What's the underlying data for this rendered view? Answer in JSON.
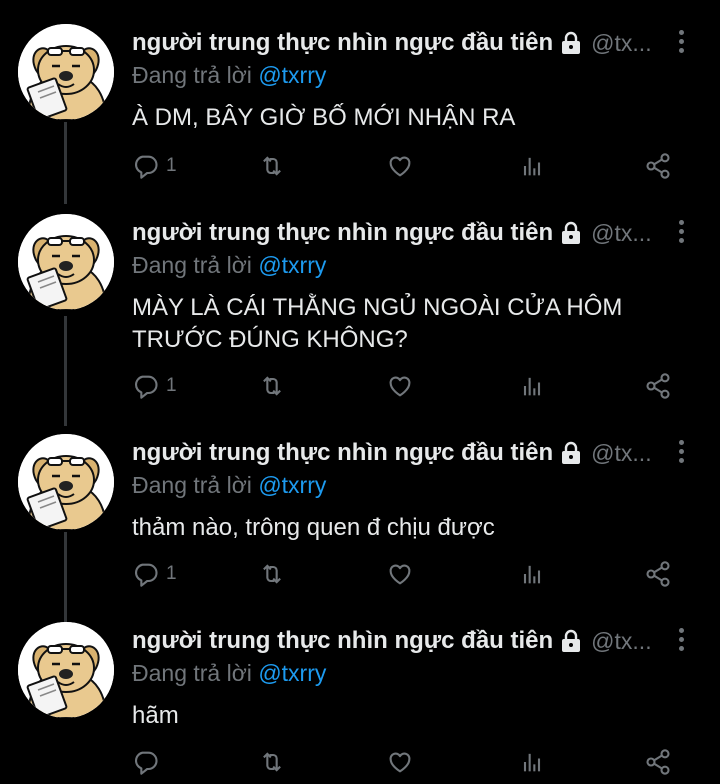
{
  "colors": {
    "background": "#000000",
    "text": "#e7e9ea",
    "muted": "#71767b",
    "accent": "#1d9bf0"
  },
  "tweets": [
    {
      "author_name": "người trung thực nhìn ngực đầu tiên",
      "handle": "@tx...",
      "replying_prefix": "Đang trả lời",
      "replying_to": "@txrry",
      "text": "À DM, BÂY GIỜ BỐ MỚI NHẬN RA",
      "reply_count": "1",
      "icons": [
        "reply-icon",
        "retweet-icon",
        "like-icon",
        "views-icon",
        "share-icon"
      ]
    },
    {
      "author_name": "người trung thực nhìn ngực đầu tiên",
      "handle": "@tx...",
      "replying_prefix": "Đang trả lời",
      "replying_to": "@txrry",
      "text": "MÀY LÀ CÁI THẰNG NGỦ NGOÀI CỬA HÔM TRƯỚC ĐÚNG KHÔNG?",
      "reply_count": "1",
      "icons": [
        "reply-icon",
        "retweet-icon",
        "like-icon",
        "views-icon",
        "share-icon"
      ]
    },
    {
      "author_name": "người trung thực nhìn ngực đầu tiên",
      "handle": "@tx...",
      "replying_prefix": "Đang trả lời",
      "replying_to": "@txrry",
      "text": "thảm nào, trông quen đ chịu được",
      "reply_count": "1",
      "icons": [
        "reply-icon",
        "retweet-icon",
        "like-icon",
        "views-icon",
        "share-icon"
      ]
    },
    {
      "author_name": "người trung thực nhìn ngực đầu tiên",
      "handle": "@tx...",
      "replying_prefix": "Đang trả lời",
      "replying_to": "@txrry",
      "text": "hãm",
      "reply_count": "",
      "icons": [
        "reply-icon",
        "retweet-icon",
        "like-icon",
        "views-icon",
        "share-icon"
      ]
    }
  ]
}
